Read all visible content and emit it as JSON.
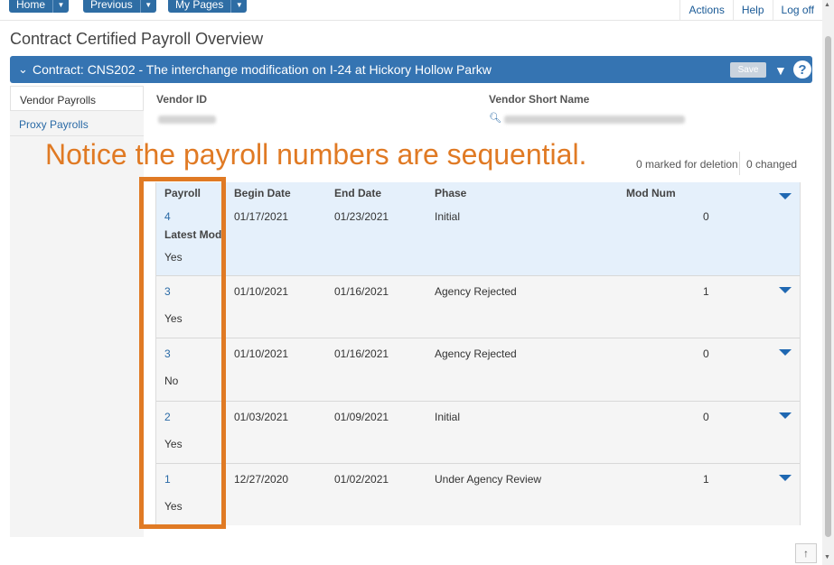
{
  "nav": {
    "home": "Home",
    "previous": "Previous",
    "mypages": "My Pages",
    "actions": "Actions",
    "help": "Help",
    "logoff": "Log off"
  },
  "page": {
    "title": "Contract Certified Payroll Overview"
  },
  "contract": {
    "title": "Contract: CNS202 - The interchange modification on I-24 at Hickory Hollow Parkw",
    "save": "Save",
    "help_symbol": "?"
  },
  "sidebar": {
    "items": [
      {
        "label": "Vendor Payrolls"
      },
      {
        "label": "Proxy Payrolls"
      }
    ]
  },
  "vendor": {
    "id_label": "Vendor ID",
    "short_name_label": "Vendor Short Name"
  },
  "annotation": "Notice the payroll numbers are sequential.",
  "counters": {
    "marked": "0 marked for deletion",
    "changed": "0 changed"
  },
  "table": {
    "headers": {
      "payroll": "Payroll",
      "begin": "Begin Date",
      "end": "End Date",
      "phase": "Phase",
      "mod": "Mod Num",
      "latest_mod": "Latest Mod"
    },
    "rows": [
      {
        "payroll": "4",
        "begin": "01/17/2021",
        "end": "01/23/2021",
        "phase": "Initial",
        "mod": "0",
        "latest": "Yes"
      },
      {
        "payroll": "3",
        "begin": "01/10/2021",
        "end": "01/16/2021",
        "phase": "Agency Rejected",
        "mod": "1",
        "latest": "Yes"
      },
      {
        "payroll": "3",
        "begin": "01/10/2021",
        "end": "01/16/2021",
        "phase": "Agency Rejected",
        "mod": "0",
        "latest": "No"
      },
      {
        "payroll": "2",
        "begin": "01/03/2021",
        "end": "01/09/2021",
        "phase": "Initial",
        "mod": "0",
        "latest": "Yes"
      },
      {
        "payroll": "1",
        "begin": "12/27/2020",
        "end": "01/02/2021",
        "phase": "Under Agency Review",
        "mod": "1",
        "latest": "Yes"
      }
    ]
  },
  "colors": {
    "accent": "#3574b2",
    "annotation": "#e07a24"
  }
}
